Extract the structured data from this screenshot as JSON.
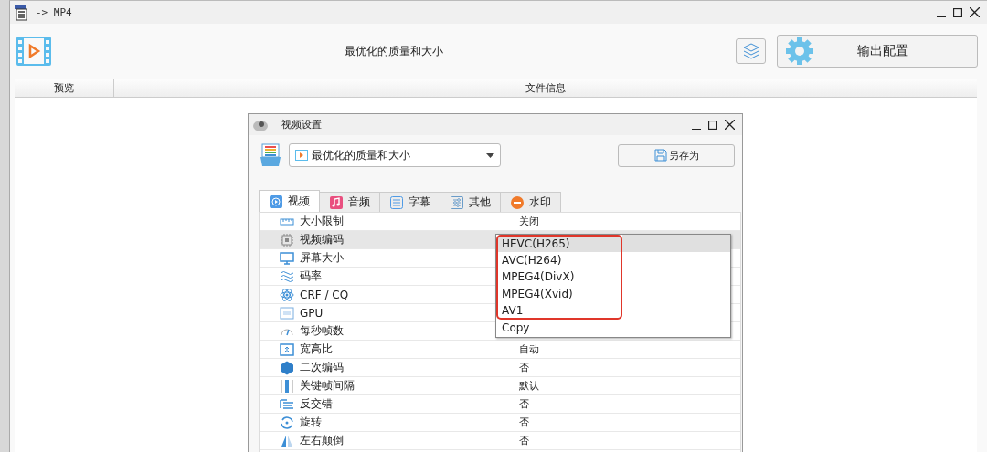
{
  "window": {
    "title": "-> MP4"
  },
  "header": {
    "preset": "最优化的质量和大小",
    "output_button": "输出配置"
  },
  "file_table": {
    "columns": [
      "预览",
      "文件信息"
    ]
  },
  "dialog": {
    "title": "视频设置",
    "preset_select": {
      "value": "最优化的质量和大小"
    },
    "save_as_button": "另存为",
    "tabs": [
      {
        "label": "视频",
        "selected": true
      },
      {
        "label": "音频",
        "selected": false
      },
      {
        "label": "字幕",
        "selected": false
      },
      {
        "label": "其他",
        "selected": false
      },
      {
        "label": "水印",
        "selected": false
      }
    ],
    "properties": [
      {
        "name": "大小限制",
        "value": "关闭",
        "selected": false
      },
      {
        "name": "视频编码",
        "selected": true
      },
      {
        "name": "屏幕大小",
        "selected": false
      },
      {
        "name": "码率",
        "selected": false
      },
      {
        "name": "CRF / CQ",
        "selected": false
      },
      {
        "name": "GPU",
        "selected": false
      },
      {
        "name": "每秒帧数",
        "selected": false
      },
      {
        "name": "宽高比",
        "value": "自动",
        "selected": false
      },
      {
        "name": "二次编码",
        "value": "否",
        "selected": false
      },
      {
        "name": "关键帧间隔",
        "value": "默认",
        "selected": false
      },
      {
        "name": "反交错",
        "value": "否",
        "selected": false
      },
      {
        "name": "旋转",
        "value": "否",
        "selected": false
      },
      {
        "name": "左右颠倒",
        "value": "否",
        "selected": false
      }
    ],
    "dropdown": {
      "options": [
        {
          "label": "HEVC(H265)",
          "selected": true,
          "marked": true
        },
        {
          "label": "AVC(H264)",
          "selected": false,
          "marked": true
        },
        {
          "label": "MPEG4(DivX)",
          "selected": false,
          "marked": true
        },
        {
          "label": "MPEG4(Xvid)",
          "selected": false,
          "marked": true
        },
        {
          "label": "AV1",
          "selected": false,
          "marked": true
        },
        {
          "label": "Copy",
          "selected": false,
          "marked": false
        }
      ]
    }
  }
}
